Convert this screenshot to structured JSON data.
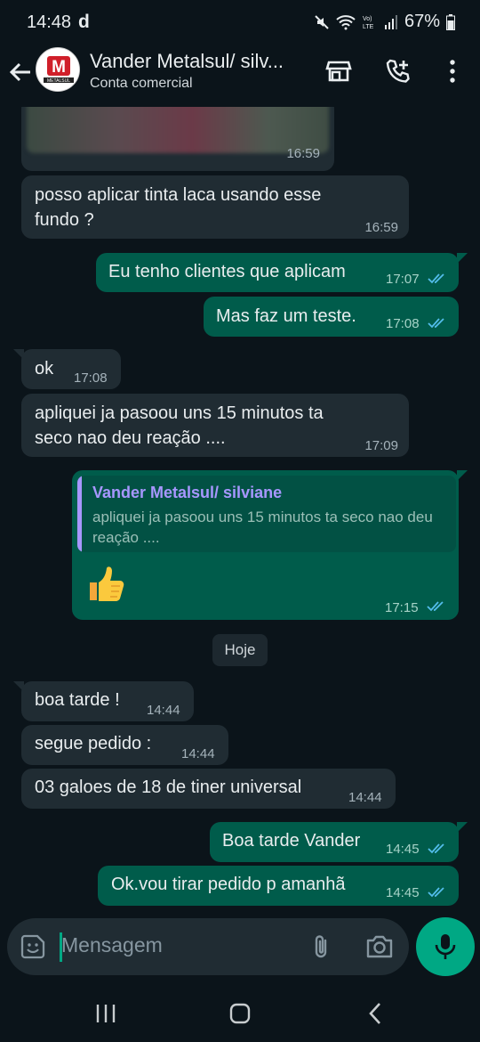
{
  "status_bar": {
    "time": "14:48",
    "carrier_mark": "d",
    "battery": "67%",
    "icons": [
      "mute-icon",
      "wifi-icon",
      "volte-icon",
      "signal-icon",
      "battery-icon"
    ]
  },
  "header": {
    "contact_name": "Vander Metalsul/ silv...",
    "subtitle": "Conta comercial",
    "avatar_letter": "M",
    "avatar_text": "METALSUL"
  },
  "messages": [
    {
      "id": "m1",
      "dir": "in",
      "media": true,
      "time": "16:59"
    },
    {
      "id": "m2",
      "dir": "in",
      "lines": [
        "posso aplicar tinta laca usando esse",
        "fundo ?"
      ],
      "time": "16:59"
    },
    {
      "id": "m3",
      "dir": "out",
      "lines": [
        "Eu tenho clientes que aplicam"
      ],
      "time": "17:07",
      "status": "read"
    },
    {
      "id": "m4",
      "dir": "out",
      "lines": [
        "Mas faz um teste."
      ],
      "time": "17:08",
      "status": "read"
    },
    {
      "id": "m5",
      "dir": "in",
      "lines": [
        "ok"
      ],
      "time": "17:08"
    },
    {
      "id": "m6",
      "dir": "in",
      "lines": [
        "apliquei ja pasoou uns 15 minutos ta",
        "seco nao deu reação ...."
      ],
      "time": "17:09"
    },
    {
      "id": "m7",
      "dir": "out",
      "quote": {
        "author": "Vander Metalsul/ silviane",
        "text": "apliquei ja pasoou uns 15 minutos ta seco nao deu reação ...."
      },
      "emoji": "👍",
      "time": "17:15",
      "status": "read"
    },
    {
      "id": "m8",
      "dir": "in",
      "lines": [
        "boa tarde !"
      ],
      "time": "14:44"
    },
    {
      "id": "m9",
      "dir": "in",
      "lines": [
        "segue pedido :"
      ],
      "time": "14:44"
    },
    {
      "id": "m10",
      "dir": "in",
      "lines": [
        "03 galoes de 18 de tiner universal"
      ],
      "time": "14:44"
    },
    {
      "id": "m11",
      "dir": "out",
      "lines": [
        "Boa tarde Vander"
      ],
      "time": "14:45",
      "status": "read"
    },
    {
      "id": "m12",
      "dir": "out",
      "lines": [
        "Ok.vou tirar pedido  p amanhã"
      ],
      "time": "14:45",
      "status": "read"
    }
  ],
  "day_separator": "Hoje",
  "composer": {
    "placeholder": "Mensagem"
  },
  "colors": {
    "background": "#0b141a",
    "incoming": "#202c33",
    "outgoing": "#005c4b",
    "accent": "#00a884",
    "read_ticks": "#53bdeb"
  }
}
